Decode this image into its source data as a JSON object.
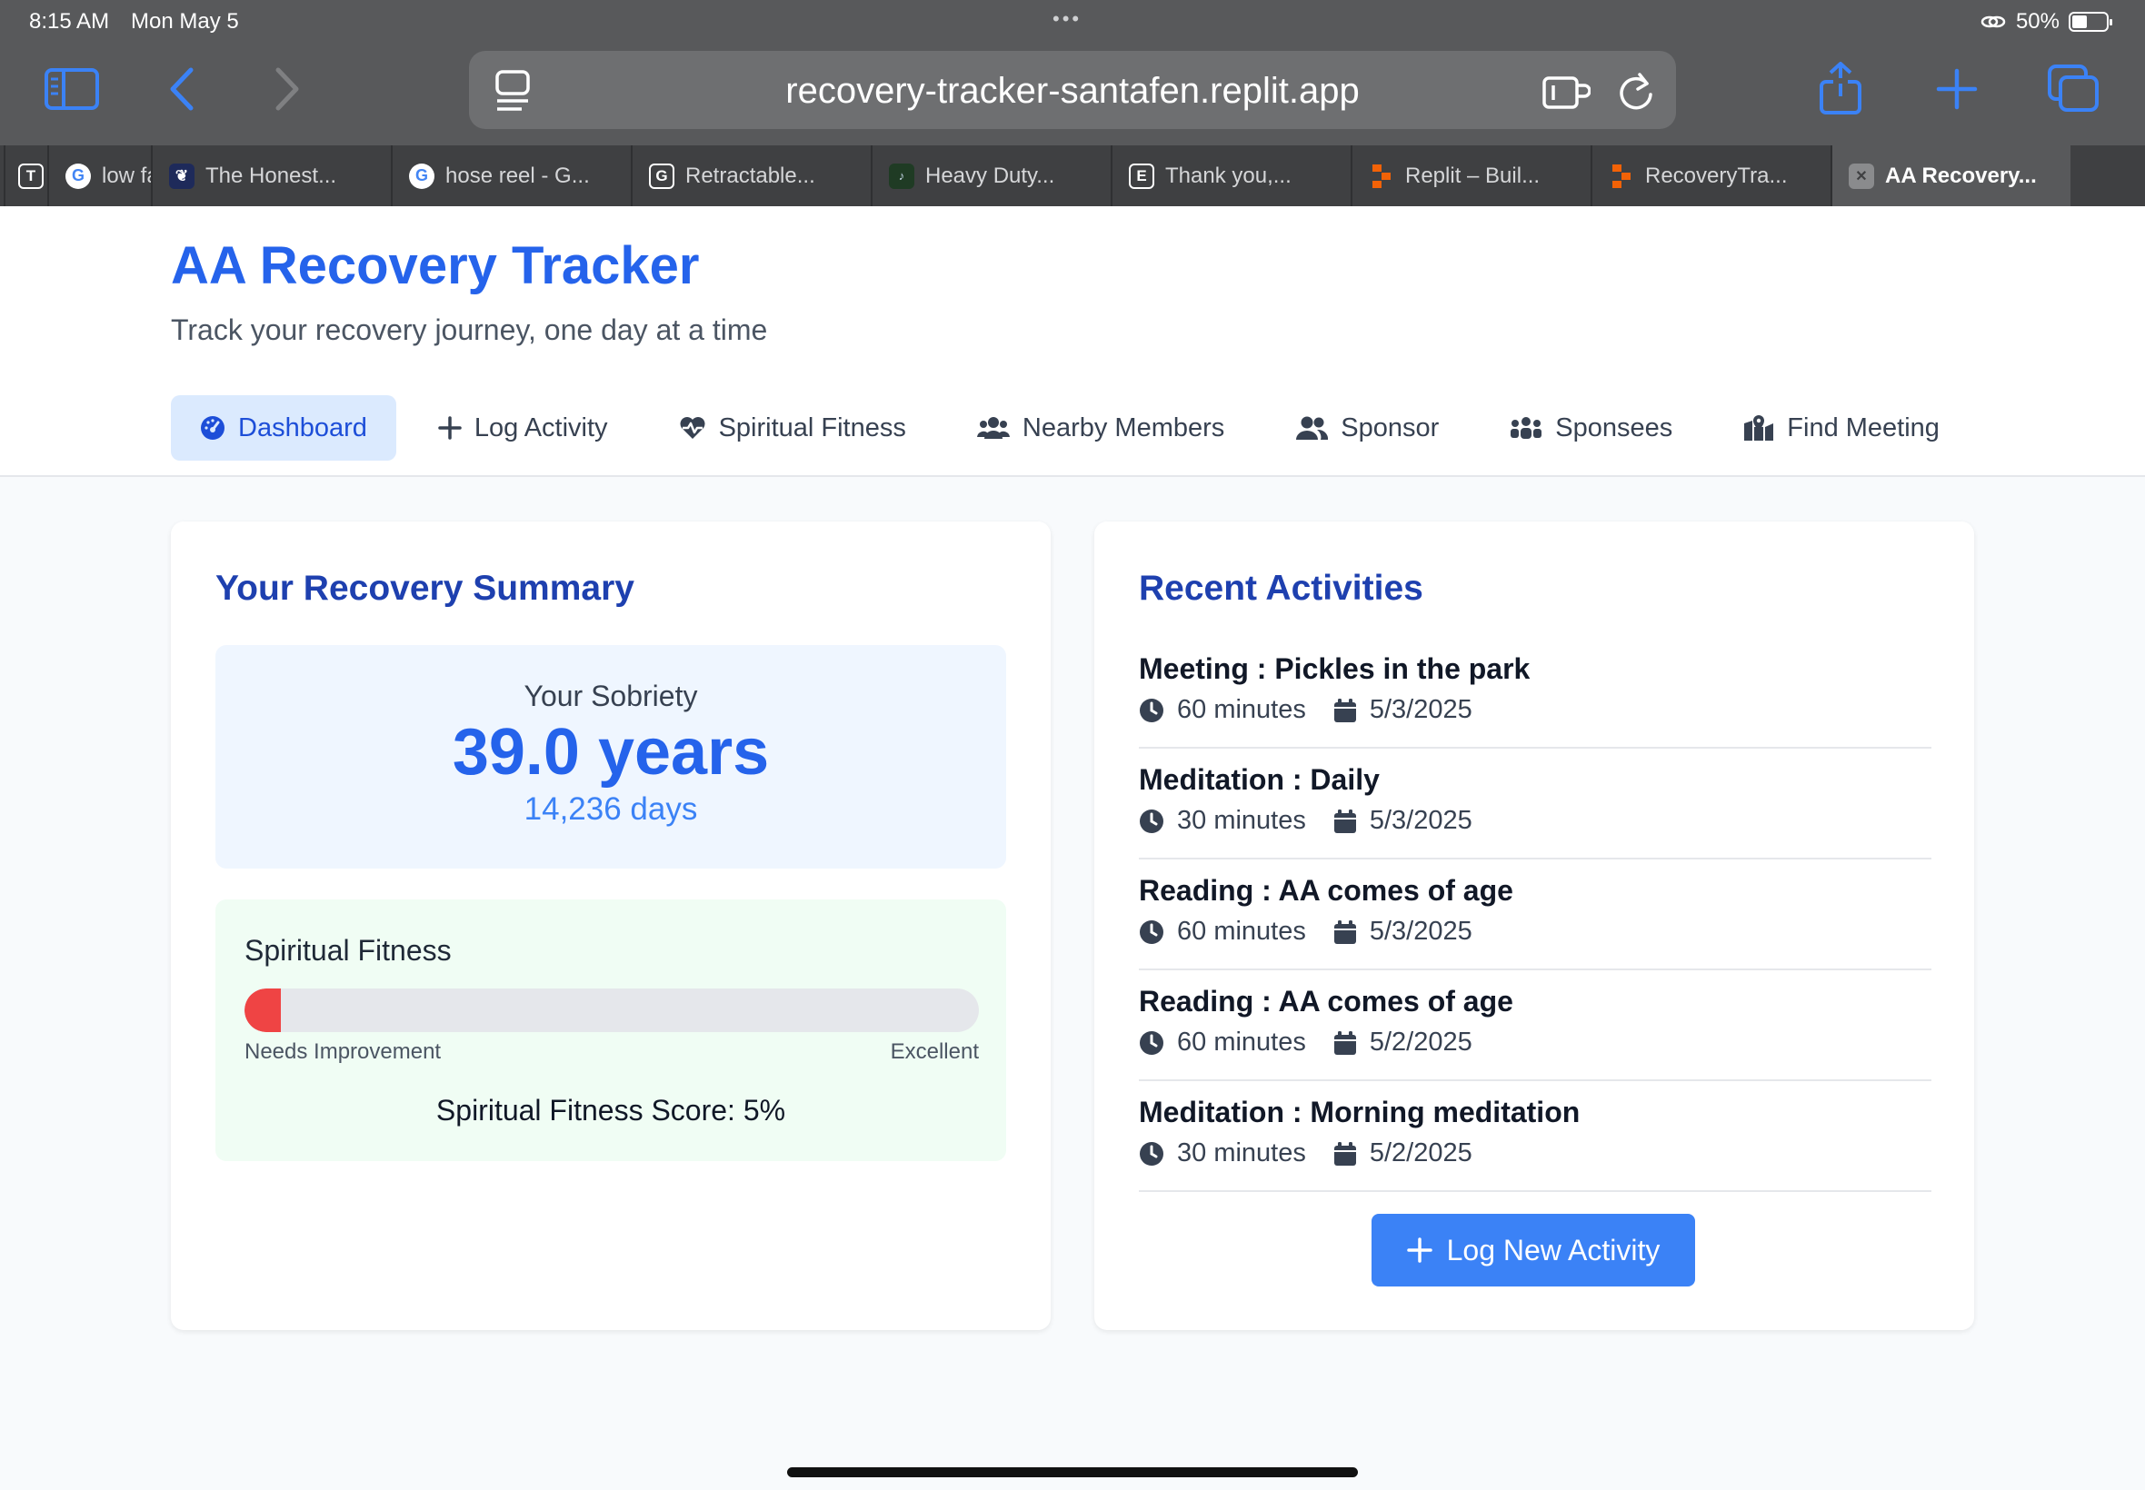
{
  "status_bar": {
    "time": "8:15 AM",
    "date": "Mon May 5",
    "battery": "50%",
    "battery_level": 0.5
  },
  "browser": {
    "url": "recovery-tracker-santafen.replit.app",
    "tabs": [
      {
        "label": "",
        "icon": "letter-t-icon",
        "fav": "T"
      },
      {
        "label": "low fa",
        "icon": "google-icon",
        "fav": "G"
      },
      {
        "label": "The Honest...",
        "icon": "honest-icon",
        "fav": ""
      },
      {
        "label": "hose reel - G...",
        "icon": "google-icon",
        "fav": "G"
      },
      {
        "label": "Retractable...",
        "icon": "letter-g-icon",
        "fav": "G"
      },
      {
        "label": "Heavy Duty...",
        "icon": "heavy-duty-icon",
        "fav": ""
      },
      {
        "label": "Thank you,...",
        "icon": "letter-e-icon",
        "fav": "E"
      },
      {
        "label": "Replit – Buil...",
        "icon": "replit-icon",
        "fav": ""
      },
      {
        "label": "RecoveryTra...",
        "icon": "replit-icon",
        "fav": ""
      },
      {
        "label": "AA Recovery...",
        "icon": "close-tab-icon",
        "fav": "✕"
      }
    ]
  },
  "app": {
    "title": "AA Recovery Tracker",
    "subtitle": "Track your recovery journey, one day at a time"
  },
  "nav": [
    {
      "label": "Dashboard",
      "icon": "gauge-icon",
      "active": true
    },
    {
      "label": "Log Activity",
      "icon": "plus-icon"
    },
    {
      "label": "Spiritual Fitness",
      "icon": "heart-pulse-icon"
    },
    {
      "label": "Nearby Members",
      "icon": "users-icon"
    },
    {
      "label": "Sponsor",
      "icon": "user-pair-icon"
    },
    {
      "label": "Sponsees",
      "icon": "group-icon"
    },
    {
      "label": "Find Meeting",
      "icon": "map-location-icon"
    }
  ],
  "summary": {
    "title": "Your Recovery Summary",
    "sobriety_label": "Your Sobriety",
    "years": "39.0 years",
    "days": "14,236 days",
    "fitness_label": "Spiritual Fitness",
    "fitness_value": 0.05,
    "low_label": "Needs Improvement",
    "high_label": "Excellent",
    "score_text": "Spiritual Fitness Score: 5%"
  },
  "activities": {
    "title": "Recent Activities",
    "items": [
      {
        "title": "Meeting : Pickles in the park",
        "duration": "60 minutes",
        "date": "5/3/2025"
      },
      {
        "title": "Meditation : Daily",
        "duration": "30 minutes",
        "date": "5/3/2025"
      },
      {
        "title": "Reading : AA comes of age",
        "duration": "60 minutes",
        "date": "5/3/2025"
      },
      {
        "title": "Reading : AA comes of age",
        "duration": "60 minutes",
        "date": "5/2/2025"
      },
      {
        "title": "Meditation : Morning meditation",
        "duration": "30 minutes",
        "date": "5/2/2025"
      }
    ],
    "button_label": "Log New Activity"
  },
  "colors": {
    "primary": "#2563eb",
    "accent_button": "#3b82f6",
    "fitness_bar": "#ef4444",
    "chrome": "#58595b"
  }
}
